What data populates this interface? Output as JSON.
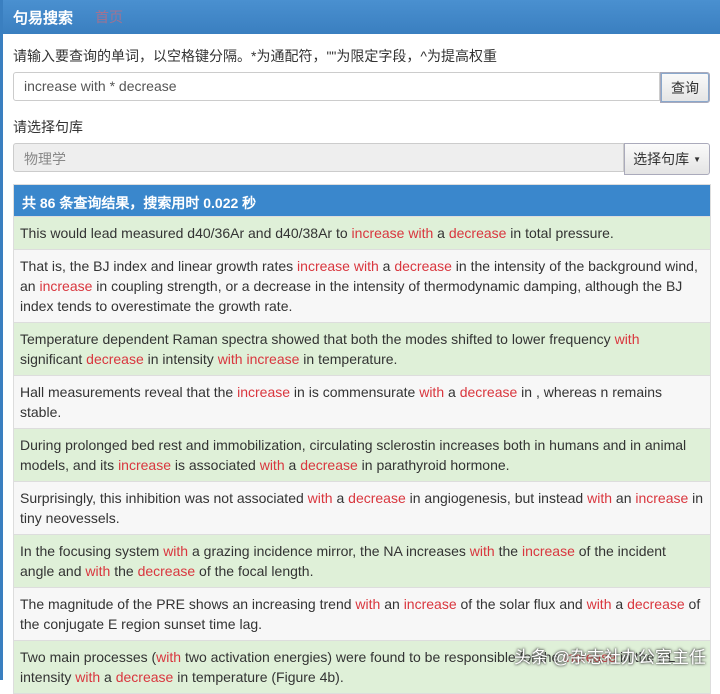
{
  "nav": {
    "brand": "句易搜索",
    "home": "首页"
  },
  "search": {
    "label": "请输入要查询的单词，以空格键分隔。*为通配符，\"\"为限定字段，^为提高权重",
    "value": "increase with * decrease",
    "button": "查询"
  },
  "library": {
    "label": "请选择句库",
    "value": "物理学",
    "button": "选择句库"
  },
  "results": {
    "summary": "共 86 条查询结果，搜索用时 0.022 秒",
    "items": [
      [
        [
          "This would lead measured d40/36Ar and d40/38Ar to ",
          0
        ],
        [
          "increase with",
          1
        ],
        [
          " a ",
          0
        ],
        [
          "decrease",
          1
        ],
        [
          " in total pressure.",
          0
        ]
      ],
      [
        [
          "That is, the BJ index and linear growth rates ",
          0
        ],
        [
          "increase with",
          1
        ],
        [
          " a ",
          0
        ],
        [
          "decrease",
          1
        ],
        [
          " in the intensity of the background wind, an ",
          0
        ],
        [
          "increase",
          1
        ],
        [
          " in coupling strength, or a decrease in the intensity of thermodynamic damping, although the BJ index tends to overestimate the growth rate.",
          0
        ]
      ],
      [
        [
          "Temperature dependent Raman spectra showed that both the modes shifted to lower frequency ",
          0
        ],
        [
          "with",
          1
        ],
        [
          " significant ",
          0
        ],
        [
          "decrease",
          1
        ],
        [
          " in intensity ",
          0
        ],
        [
          "with increase",
          1
        ],
        [
          " in temperature.",
          0
        ]
      ],
      [
        [
          "Hall measurements reveal that the ",
          0
        ],
        [
          "increase",
          1
        ],
        [
          " in is commensurate ",
          0
        ],
        [
          "with",
          1
        ],
        [
          " a ",
          0
        ],
        [
          "decrease",
          1
        ],
        [
          " in , whereas n remains stable.",
          0
        ]
      ],
      [
        [
          "During prolonged bed rest and immobilization, circulating sclerostin increases both in humans and in animal models, and its ",
          0
        ],
        [
          "increase",
          1
        ],
        [
          " is associated ",
          0
        ],
        [
          "with",
          1
        ],
        [
          " a ",
          0
        ],
        [
          "decrease",
          1
        ],
        [
          " in parathyroid hormone.",
          0
        ]
      ],
      [
        [
          "Surprisingly, this inhibition was not associated ",
          0
        ],
        [
          "with",
          1
        ],
        [
          " a ",
          0
        ],
        [
          "decrease",
          1
        ],
        [
          " in angiogenesis, but instead ",
          0
        ],
        [
          "with",
          1
        ],
        [
          " an ",
          0
        ],
        [
          "increase",
          1
        ],
        [
          " in tiny neovessels.",
          0
        ]
      ],
      [
        [
          "In the focusing system ",
          0
        ],
        [
          "with",
          1
        ],
        [
          " a grazing incidence mirror, the NA increases ",
          0
        ],
        [
          "with",
          1
        ],
        [
          " the ",
          0
        ],
        [
          "increase",
          1
        ],
        [
          " of the incident angle and ",
          0
        ],
        [
          "with",
          1
        ],
        [
          " the ",
          0
        ],
        [
          "decrease",
          1
        ],
        [
          " of the focal length.",
          0
        ]
      ],
      [
        [
          "The magnitude of the PRE shows an increasing trend ",
          0
        ],
        [
          "with",
          1
        ],
        [
          " an ",
          0
        ],
        [
          "increase",
          1
        ],
        [
          " of the solar flux and ",
          0
        ],
        [
          "with",
          1
        ],
        [
          " a ",
          0
        ],
        [
          "decrease",
          1
        ],
        [
          " of the conjugate E region sunset time lag.",
          0
        ]
      ],
      [
        [
          "Two main processes (",
          0
        ],
        [
          "with",
          1
        ],
        [
          " two activation energies) were found to be responsible for the ",
          0
        ],
        [
          "increase",
          1
        ],
        [
          " in the PL intensity ",
          0
        ],
        [
          "with",
          1
        ],
        [
          " a ",
          0
        ],
        [
          "decrease",
          1
        ],
        [
          " in temperature (Figure 4b).",
          0
        ]
      ]
    ]
  },
  "watermark": "头条 @杂志社办公室主任"
}
